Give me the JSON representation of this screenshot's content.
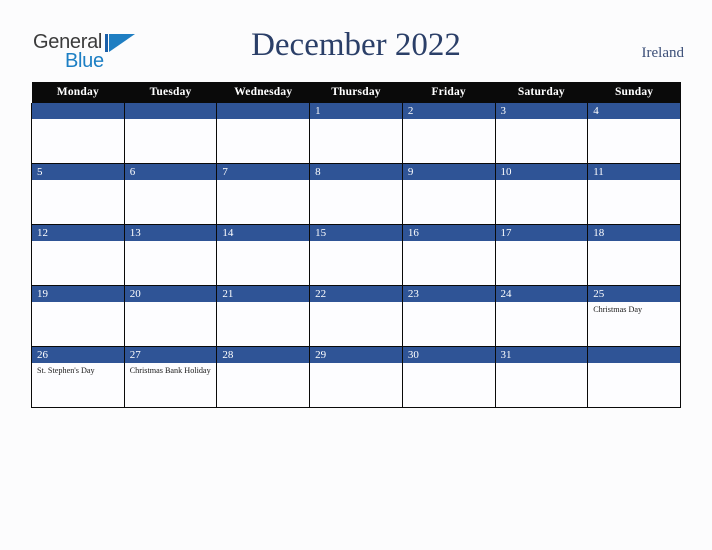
{
  "brand": {
    "name_part1": "General",
    "name_part2": "Blue",
    "triangle_icon": "triangle-icon",
    "accent_color": "#1f7ec2"
  },
  "header": {
    "title": "December 2022",
    "country": "Ireland",
    "title_color": "#2b3f68"
  },
  "calendar": {
    "weekday_headers": [
      "Monday",
      "Tuesday",
      "Wednesday",
      "Thursday",
      "Friday",
      "Saturday",
      "Sunday"
    ],
    "header_bg": "#0a0a0a",
    "daybar_bg": "#2f5496",
    "cell_bg": "#fdfdff",
    "weeks": [
      [
        {
          "day": "",
          "events": []
        },
        {
          "day": "",
          "events": []
        },
        {
          "day": "",
          "events": []
        },
        {
          "day": "1",
          "events": []
        },
        {
          "day": "2",
          "events": []
        },
        {
          "day": "3",
          "events": []
        },
        {
          "day": "4",
          "events": []
        }
      ],
      [
        {
          "day": "5",
          "events": []
        },
        {
          "day": "6",
          "events": []
        },
        {
          "day": "7",
          "events": []
        },
        {
          "day": "8",
          "events": []
        },
        {
          "day": "9",
          "events": []
        },
        {
          "day": "10",
          "events": []
        },
        {
          "day": "11",
          "events": []
        }
      ],
      [
        {
          "day": "12",
          "events": []
        },
        {
          "day": "13",
          "events": []
        },
        {
          "day": "14",
          "events": []
        },
        {
          "day": "15",
          "events": []
        },
        {
          "day": "16",
          "events": []
        },
        {
          "day": "17",
          "events": []
        },
        {
          "day": "18",
          "events": []
        }
      ],
      [
        {
          "day": "19",
          "events": []
        },
        {
          "day": "20",
          "events": []
        },
        {
          "day": "21",
          "events": []
        },
        {
          "day": "22",
          "events": []
        },
        {
          "day": "23",
          "events": []
        },
        {
          "day": "24",
          "events": []
        },
        {
          "day": "25",
          "events": [
            "Christmas Day"
          ]
        }
      ],
      [
        {
          "day": "26",
          "events": [
            "St. Stephen's Day"
          ]
        },
        {
          "day": "27",
          "events": [
            "Christmas Bank Holiday"
          ]
        },
        {
          "day": "28",
          "events": []
        },
        {
          "day": "29",
          "events": []
        },
        {
          "day": "30",
          "events": []
        },
        {
          "day": "31",
          "events": []
        },
        {
          "day": "",
          "events": []
        }
      ]
    ]
  }
}
